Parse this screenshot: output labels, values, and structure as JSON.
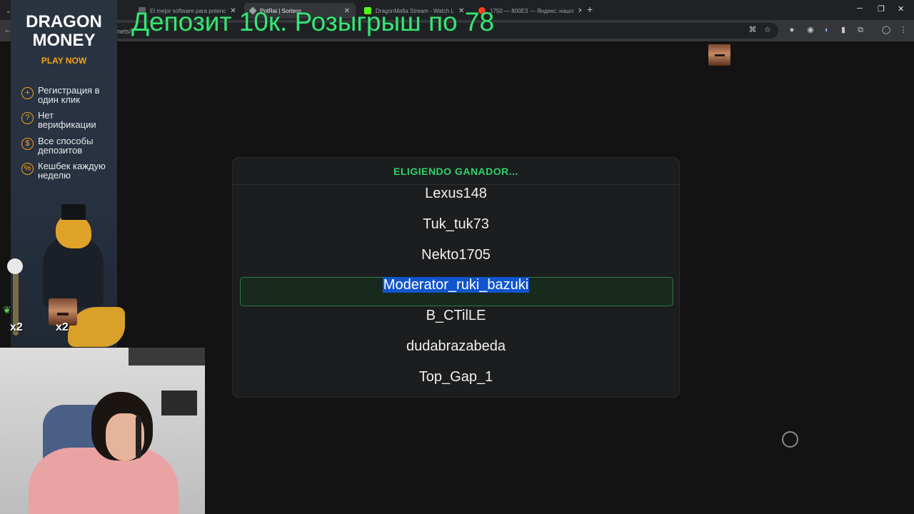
{
  "browser": {
    "tabs": [
      {
        "title": "",
        "active": false
      },
      {
        "title": "El mejor software para potenc",
        "active": false
      },
      {
        "title": "PotRai | Sorteos",
        "active": true
      },
      {
        "title": "DragonMafia Stream - Watch L",
        "active": false
      },
      {
        "title": "1750 — 800E3 — Яндекс: нашл",
        "active": false
      }
    ],
    "address_fragment": "nets/"
  },
  "overlay": {
    "title": "Депозит 10к. Розыгрыш по 78"
  },
  "raffle": {
    "header": "ELIGIENDO GANADOR...",
    "names": [
      "Lexus148",
      "Tuk_tuk73",
      "Nekto1705",
      "Moderator_ruki_bazuki",
      "B_CTilLE",
      "dudabrazabeda",
      "Top_Gap_1"
    ],
    "highlighted_name": "Moderator_ruki_bazuki",
    "accent_color": "#2fd16a"
  },
  "sponsor": {
    "logo_line1": "DRAGON",
    "logo_line2": "MONEY",
    "cta": "PLAY NOW",
    "features": [
      {
        "icon": "plus-icon",
        "text": "Регистрация в один клик"
      },
      {
        "icon": "question-icon",
        "text": "Нет верификации"
      },
      {
        "icon": "coin-icon",
        "text": "Все способы депозитов"
      },
      {
        "icon": "cashback-icon",
        "text": "Кешбек каждую неделю"
      }
    ],
    "multipliers": [
      "x2",
      "x2"
    ]
  }
}
